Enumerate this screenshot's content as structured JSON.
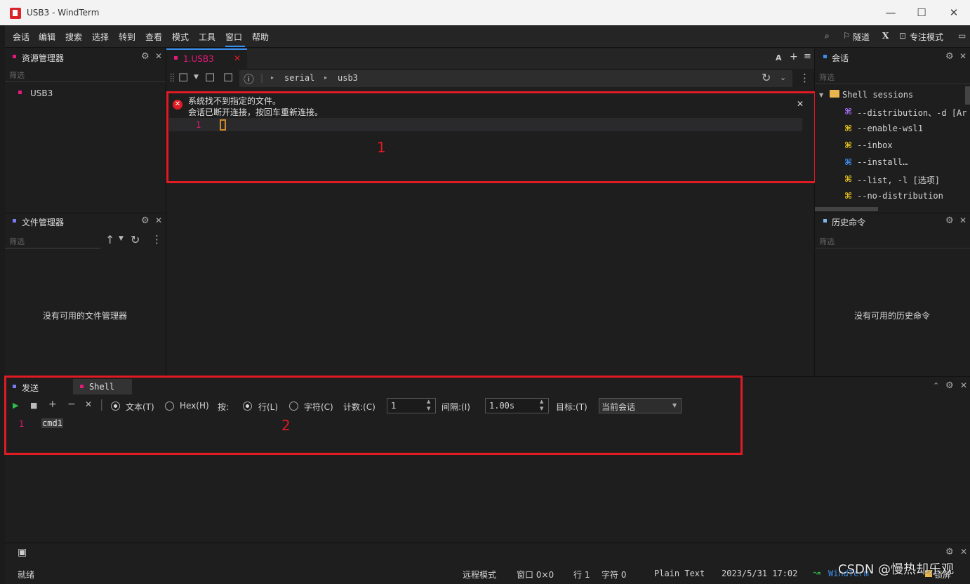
{
  "window": {
    "title": "USB3 - WindTerm",
    "minimize_glyph": "—",
    "maximize_glyph": "☐",
    "close_glyph": "✕"
  },
  "menu": {
    "items": [
      "会话",
      "编辑",
      "搜索",
      "选择",
      "转到",
      "查看",
      "模式",
      "工具",
      "窗口",
      "帮助"
    ],
    "right": {
      "tunnel": "隧道",
      "x_label": "X",
      "focus_mode": "专注模式"
    }
  },
  "explorer": {
    "title": "资源管理器",
    "filter_placeholder": "筛选",
    "items": [
      {
        "label": "USB3",
        "color": "#e6197a"
      }
    ]
  },
  "file_manager": {
    "title": "文件管理器",
    "filter_placeholder": "筛选",
    "empty_text": "没有可用的文件管理器"
  },
  "editor": {
    "tab_label": "1.USB3",
    "tab_color": "#e6197a",
    "font_button": "A",
    "breadcrumb": [
      "serial",
      "usb3"
    ],
    "error_line1": "系统找不到指定的文件。",
    "error_line2": "会话已断开连接，按回车重新连接。",
    "line_number": "1",
    "annotation": "1"
  },
  "sessions": {
    "title": "会话",
    "filter_placeholder": "筛选",
    "group": "Shell sessions",
    "items": [
      {
        "label": "--distribution、-d [Ar",
        "icon_color": "#a36cf2"
      },
      {
        "label": "--enable-wsl1",
        "icon_color": "#e6c21a"
      },
      {
        "label": "--inbox",
        "icon_color": "#e6c21a"
      },
      {
        "label": "--install…",
        "icon_color": "#3b8eea"
      },
      {
        "label": "--list, -l [选项]",
        "icon_color": "#e6c21a"
      },
      {
        "label": "--no-distribution",
        "icon_color": "#e6c21a"
      }
    ]
  },
  "history": {
    "title": "历史命令",
    "filter_placeholder": "筛选",
    "empty_text": "没有可用的历史命令"
  },
  "send_panel": {
    "tabs": [
      {
        "label": "发送",
        "color": "#7b7bf0"
      },
      {
        "label": "Shell",
        "color": "#e6197a"
      }
    ],
    "text_mode": "文本(T)",
    "hex_mode": "Hex(H)",
    "by_label": "按:",
    "line_mode": "行(L)",
    "char_mode": "字符(C)",
    "count_label": "计数:(C)",
    "count_value": "1",
    "interval_label": "间隔:(I)",
    "interval_value": "1.00s",
    "target_label": "目标:(T)",
    "target_value": "当前会话",
    "line_number": "1",
    "command": "cmd1",
    "annotation": "2"
  },
  "status": {
    "ready": "就绪",
    "remote_mode": "远程模式",
    "window": "窗口 0×0",
    "row": "行 1",
    "col": "字符 0",
    "syntax": "Plain Text",
    "datetime": "2023/5/31 17:02",
    "app_name": "WindTerm",
    "watermark": "CSDN @慢热却乐观",
    "lock_label": "锁屏"
  },
  "colors": {
    "highlight_red": "#e01b24",
    "accent_pink": "#e6197a",
    "accent_blue": "#3b8eea"
  }
}
